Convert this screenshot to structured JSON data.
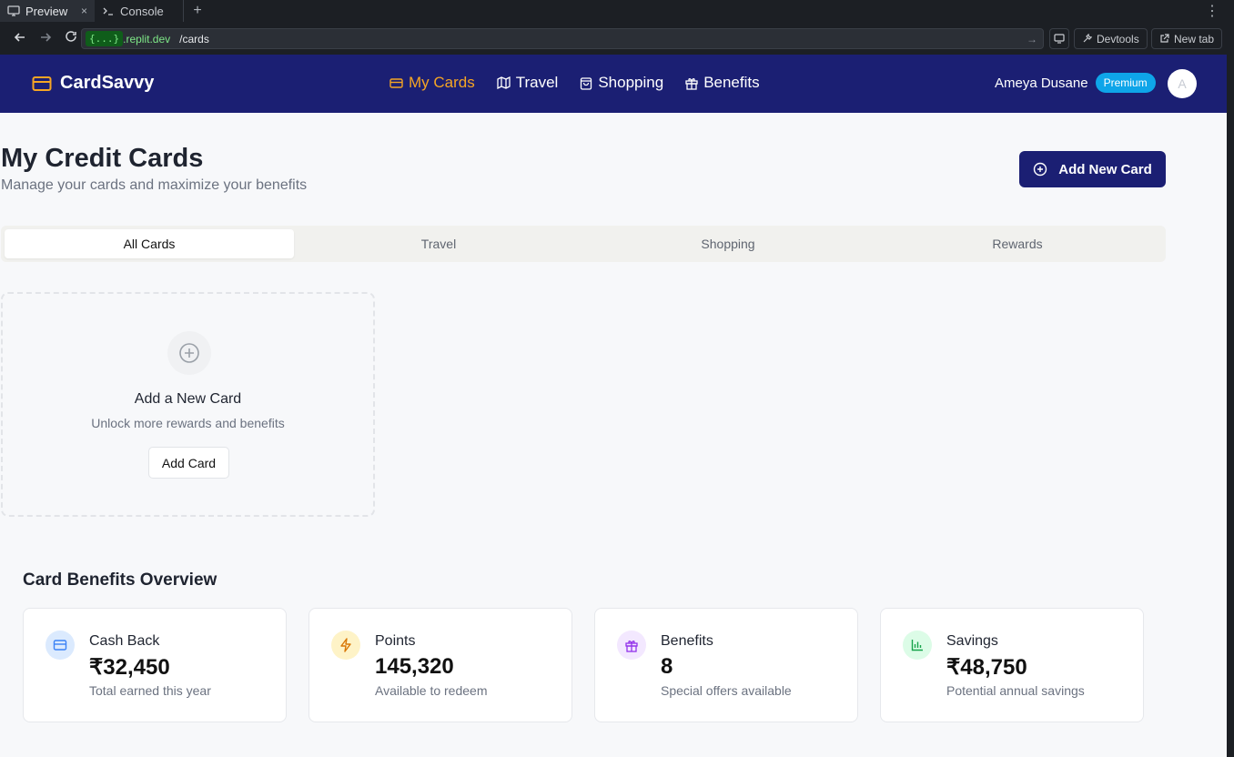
{
  "browser": {
    "tabs": [
      {
        "label": "Preview",
        "close": "×"
      },
      {
        "label": "Console"
      }
    ],
    "add_tab": "+",
    "menu": "⋮",
    "url_host_badge": "{...}",
    "url_host": ".replit.dev",
    "url_path": "/cards",
    "devtools_label": "Devtools",
    "new_tab_label": "New tab"
  },
  "header": {
    "brand": "CardSavvy",
    "nav": [
      {
        "label": "My Cards",
        "icon": "credit-card-icon",
        "active": true
      },
      {
        "label": "Travel",
        "icon": "map-icon"
      },
      {
        "label": "Shopping",
        "icon": "shopping-bag-icon"
      },
      {
        "label": "Benefits",
        "icon": "gift-icon"
      }
    ],
    "user_name": "Ameya Dusane",
    "badge": "Premium",
    "avatar_initial": "A"
  },
  "page": {
    "title": "My Credit Cards",
    "subtitle": "Manage your cards and maximize your benefits",
    "add_button": "Add New Card",
    "tabs": [
      "All Cards",
      "Travel",
      "Shopping",
      "Rewards"
    ],
    "active_tab": "All Cards"
  },
  "add_card": {
    "title": "Add a New Card",
    "subtitle": "Unlock more rewards and benefits",
    "button": "Add Card"
  },
  "overview": {
    "title": "Card Benefits Overview",
    "stats": [
      {
        "label": "Cash Back",
        "value": "₹32,450",
        "desc": "Total earned this year",
        "icon": "credit-card-icon",
        "color": "#3b82f6",
        "bg": "#dbeafe"
      },
      {
        "label": "Points",
        "value": "145,320",
        "desc": "Available to redeem",
        "icon": "lightning-icon",
        "color": "#d97706",
        "bg": "#fef3c7"
      },
      {
        "label": "Benefits",
        "value": "8",
        "desc": "Special offers available",
        "icon": "gift-icon",
        "color": "#9333ea",
        "bg": "#f3e8ff"
      },
      {
        "label": "Savings",
        "value": "₹48,750",
        "desc": "Potential annual savings",
        "icon": "bar-chart-icon",
        "color": "#16a34a",
        "bg": "#dcfce7"
      }
    ]
  },
  "colors": {
    "nav_bg": "#1b1f73",
    "accent": "#f5a524",
    "premium": "#0ea5e9"
  }
}
